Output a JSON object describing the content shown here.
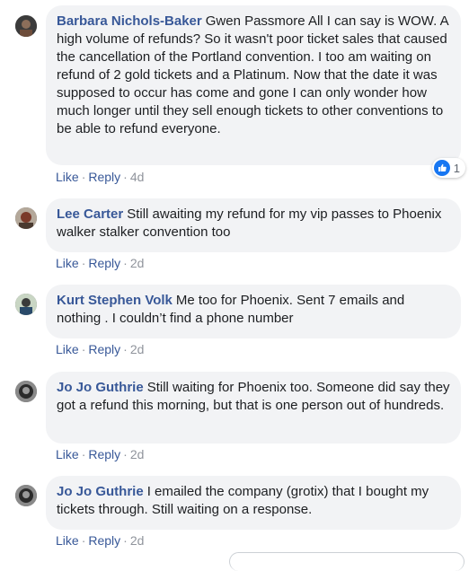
{
  "comments": [
    {
      "author": "Barbara Nichols-Baker",
      "text": "Gwen Passmore All I can say is WOW. A high volume of refunds? So it wasn't poor ticket sales that caused the cancellation of the Portland convention. I too am waiting on refund of 2 gold tickets and a Platinum. Now that the date it was supposed to occur has come and gone I can only wonder how much longer until they sell enough tickets to other conventions to be able to refund everyone.",
      "like": "Like",
      "reply": "Reply",
      "time": "4d",
      "reaction_count": "1"
    },
    {
      "author": "Lee Carter",
      "text": "Still awaiting my refund for my vip passes to Phoenix walker stalker convention too",
      "like": "Like",
      "reply": "Reply",
      "time": "2d"
    },
    {
      "author": "Kurt Stephen Volk",
      "text": "Me too for Phoenix. Sent 7 emails and nothing . I couldn’t find a phone number",
      "like": "Like",
      "reply": "Reply",
      "time": "2d"
    },
    {
      "author": "Jo Jo Guthrie",
      "text": "Still waiting for Phoenix too. Someone did say they got a refund this morning, but that is one person out of hundreds.",
      "like": "Like",
      "reply": "Reply",
      "time": "2d"
    },
    {
      "author": "Jo Jo Guthrie",
      "text": "I emailed the company (grotix) that I bought my tickets through. Still waiting on a response.",
      "like": "Like",
      "reply": "Reply",
      "time": "2d"
    }
  ],
  "icons": {
    "reaction": "like-icon",
    "avatar": "profile-photo"
  },
  "colors": {
    "author": "#385898",
    "bubble": "#f2f3f5",
    "like_blue": "#1877f2"
  }
}
